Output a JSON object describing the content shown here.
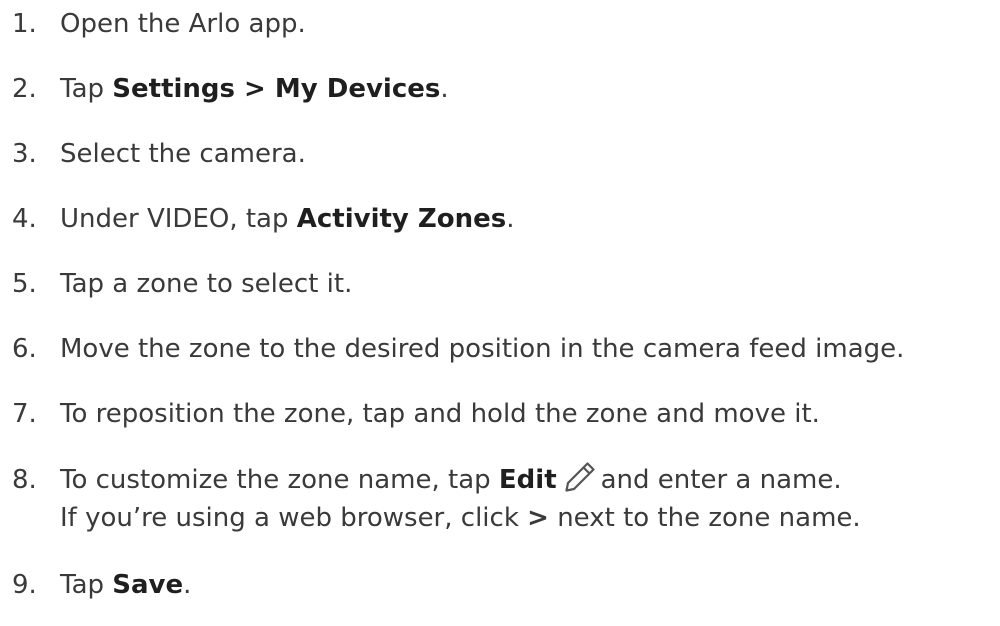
{
  "steps": [
    {
      "num": "1.",
      "text": "Open the Arlo app."
    },
    {
      "num": "2.",
      "pre": "Tap ",
      "bold": "Settings > My Devices",
      "post": "."
    },
    {
      "num": "3.",
      "text": "Select the camera."
    },
    {
      "num": "4.",
      "pre": "Under VIDEO, tap ",
      "bold": "Activity Zones",
      "post": "."
    },
    {
      "num": "5.",
      "text": "Tap a zone to select it."
    },
    {
      "num": "6.",
      "text": "Move the zone to the desired position in the camera feed image."
    },
    {
      "num": "7.",
      "text": "To reposition the zone, tap and hold the zone and move it."
    },
    {
      "num": "8.",
      "pre": "To customize the zone name, tap ",
      "bold": "Edit",
      "icon": "pencil-icon",
      "post": "and enter a name.",
      "line2_pre": "If you’re using a web browser, click ",
      "line2_bold": ">",
      "line2_post": " next to the zone name."
    },
    {
      "num": "9.",
      "pre": "Tap ",
      "bold": "Save",
      "post": "."
    }
  ]
}
